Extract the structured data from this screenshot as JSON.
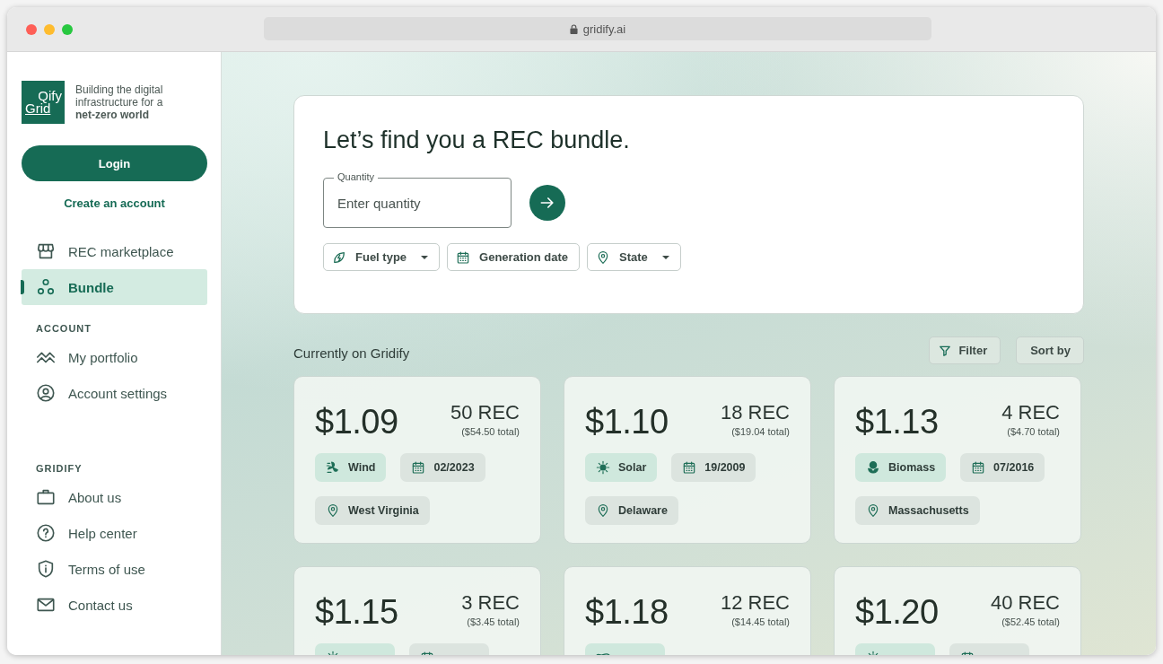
{
  "browser": {
    "url": "gridify.ai"
  },
  "sidebar": {
    "logo": {
      "top": "Qify",
      "bottom": "Grid"
    },
    "tagline": "Building the digital infrastructure for a **net-zero world**",
    "login_button": "Login",
    "create_account_link": "Create an account",
    "sections": [
      {
        "items": [
          {
            "label": "REC marketplace",
            "kind": "store",
            "selected": false
          },
          {
            "label": "Bundle",
            "kind": "bundle",
            "selected": true
          }
        ]
      },
      {
        "heading": "ACCOUNT",
        "items": [
          {
            "label": "My portfolio",
            "kind": "chart",
            "selected": false
          },
          {
            "label": "Account settings",
            "kind": "user",
            "selected": false
          }
        ]
      },
      {
        "heading": "GRIDIFY",
        "items": [
          {
            "label": "About us",
            "kind": "briefcase",
            "selected": false
          },
          {
            "label": "Help center",
            "kind": "help",
            "selected": false
          },
          {
            "label": "Terms of use",
            "kind": "shield",
            "selected": false
          },
          {
            "label": "Contact us",
            "kind": "mail",
            "selected": false
          }
        ]
      }
    ]
  },
  "search": {
    "title": "Let’s find you a REC bundle.",
    "quantity_field": {
      "label": "Quantity",
      "placeholder": "Enter quantity"
    },
    "filters": [
      {
        "label": "Fuel type",
        "kind": "fuel",
        "dropdown": true
      },
      {
        "label": "Generation date",
        "kind": "date",
        "dropdown": false
      },
      {
        "label": "State",
        "kind": "state",
        "dropdown": true
      }
    ]
  },
  "listing": {
    "heading": "Currently on Gridify",
    "filter_button": "Filter",
    "sort_button": "Sort by",
    "cards": [
      {
        "price": "$1.09",
        "quantity": "50 REC",
        "total": "($54.50 total)",
        "fuel": {
          "kind": "wind",
          "label": "Wind"
        },
        "date": "02/2023",
        "state": "West Virginia"
      },
      {
        "price": "$1.10",
        "quantity": "18 REC",
        "total": "($19.04 total)",
        "fuel": {
          "kind": "solar",
          "label": "Solar"
        },
        "date": "19/2009",
        "state": "Delaware"
      },
      {
        "price": "$1.13",
        "quantity": "4 REC",
        "total": "($4.70 total)",
        "fuel": {
          "kind": "biomass",
          "label": "Biomass"
        },
        "date": "07/2016",
        "state": "Massachusetts"
      },
      {
        "price": "$1.15",
        "quantity": "3 REC",
        "total": "($3.45 total)",
        "fuel": {
          "kind": "solar"
        },
        "date_tag": true
      },
      {
        "price": "$1.18",
        "quantity": "12 REC",
        "total": "($14.45 total)",
        "fuel": {
          "kind": "hydro"
        },
        "date_tag": false
      },
      {
        "price": "$1.20",
        "quantity": "40 REC",
        "total": "($52.45 total)",
        "fuel": {
          "kind": "solar"
        },
        "date_tag": true
      }
    ]
  }
}
